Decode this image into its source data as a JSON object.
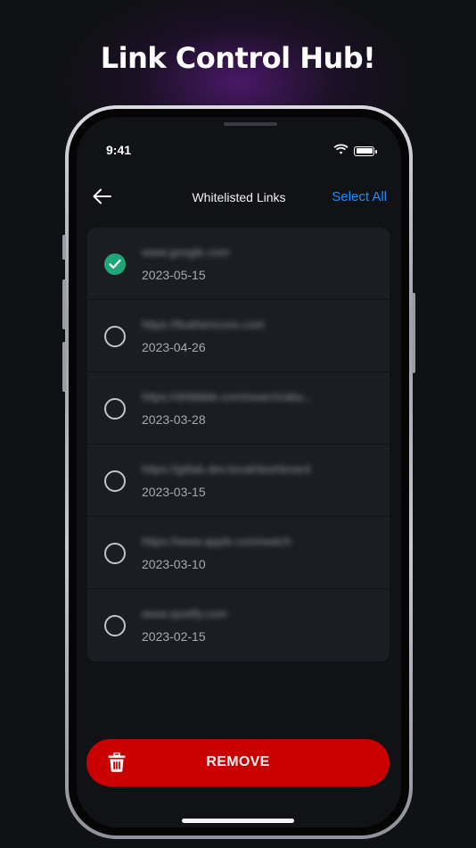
{
  "headline": "Link Control Hub!",
  "status_bar": {
    "time": "9:41",
    "wifi_icon": "wifi-icon",
    "battery_icon": "battery-icon"
  },
  "nav": {
    "title": "Whitelisted Links",
    "select_all": "Select All",
    "back_icon": "arrow-left-icon"
  },
  "links": [
    {
      "url": "www.google.com",
      "date": "2023-05-15",
      "selected": true
    },
    {
      "url": "https://feathericons.com",
      "date": "2023-04-26",
      "selected": false
    },
    {
      "url": "https://dribbble.com/search/abu...",
      "date": "2023-03-28",
      "selected": false
    },
    {
      "url": "https://gitlab.dev.local/dashboard",
      "date": "2023-03-15",
      "selected": false
    },
    {
      "url": "https://www.apple.com/watch",
      "date": "2023-03-10",
      "selected": false
    },
    {
      "url": "www.spotify.com",
      "date": "2023-02-15",
      "selected": false
    }
  ],
  "remove_button": {
    "label": "REMOVE",
    "icon": "trash-icon"
  },
  "colors": {
    "accent_blue": "#1e8cff",
    "check_green": "#1fa678",
    "remove_red": "#c90000",
    "background": "#101114"
  }
}
